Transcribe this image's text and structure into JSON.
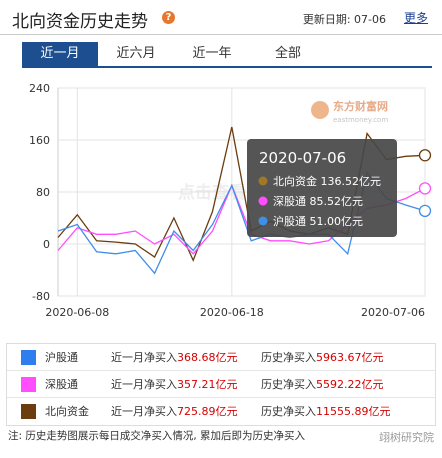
{
  "header": {
    "title": "北向资金历史走势",
    "help_glyph": "?",
    "update_label": "更新日期: 07-06",
    "more_label": "更多"
  },
  "tabs": [
    {
      "label": "近一月",
      "active": true
    },
    {
      "label": "近六月",
      "active": false
    },
    {
      "label": "近一年",
      "active": false
    },
    {
      "label": "全部",
      "active": false
    }
  ],
  "watermarks": {
    "logo": "东方财富网",
    "logo_sub": "eastmoney.com",
    "center": "点击查看"
  },
  "chart_data": {
    "type": "line",
    "y_ticks": [
      "240",
      "160",
      "80",
      "0",
      "-80"
    ],
    "ylim": [
      -80,
      240
    ],
    "x_tick_labels": [
      "2020-06-08",
      "2020-06-18",
      "2020-07-06"
    ],
    "x": [
      "06-05",
      "06-08",
      "06-09",
      "06-10",
      "06-11",
      "06-12",
      "06-15",
      "06-16",
      "06-17",
      "06-18",
      "06-19",
      "06-22",
      "06-23",
      "06-24",
      "06-29",
      "06-30",
      "07-01",
      "07-02",
      "07-03",
      "07-06"
    ],
    "series": [
      {
        "name": "北向资金",
        "color": "#6b3d0e",
        "values": [
          10,
          45,
          5,
          3,
          0,
          -20,
          40,
          -25,
          50,
          180,
          20,
          35,
          20,
          15,
          25,
          15,
          170,
          130,
          135,
          136.52
        ]
      },
      {
        "name": "深股通",
        "color": "#ff4dff",
        "values": [
          -10,
          25,
          15,
          15,
          20,
          0,
          15,
          -15,
          20,
          90,
          15,
          5,
          5,
          0,
          5,
          30,
          55,
          60,
          70,
          85.52
        ]
      },
      {
        "name": "沪股通",
        "color": "#3f8ee8",
        "values": [
          20,
          30,
          -12,
          -15,
          -10,
          -45,
          20,
          -10,
          30,
          90,
          5,
          15,
          10,
          15,
          15,
          -15,
          110,
          70,
          60,
          51.0
        ]
      }
    ],
    "tooltip": {
      "date": "2020-07-06",
      "rows": [
        {
          "label": "北向资金 136.52亿元",
          "color": "#a07828"
        },
        {
          "label": "深股通 85.52亿元",
          "color": "#ff4dff"
        },
        {
          "label": "沪股通 51.00亿元",
          "color": "#3f8ee8"
        }
      ]
    }
  },
  "legend": [
    {
      "name": "沪股通",
      "color": "#2f7ef0",
      "month_label": "近一月净买入",
      "month_value": "368.68亿元",
      "hist_label": "历史净买入",
      "hist_value": "5963.67亿元"
    },
    {
      "name": "深股通",
      "color": "#ff4dff",
      "month_label": "近一月净买入",
      "month_value": "357.21亿元",
      "hist_label": "历史净买入",
      "hist_value": "5592.22亿元"
    },
    {
      "name": "北向资金",
      "color": "#6b3d0e",
      "month_label": "近一月净买入",
      "month_value": "725.89亿元",
      "hist_label": "历史净买入",
      "hist_value": "11555.89亿元"
    }
  ],
  "note": "注: 历史走势图展示每日成交净买入情况, 累加后即为历史净买入",
  "wechat_mark": "翊树研究院"
}
